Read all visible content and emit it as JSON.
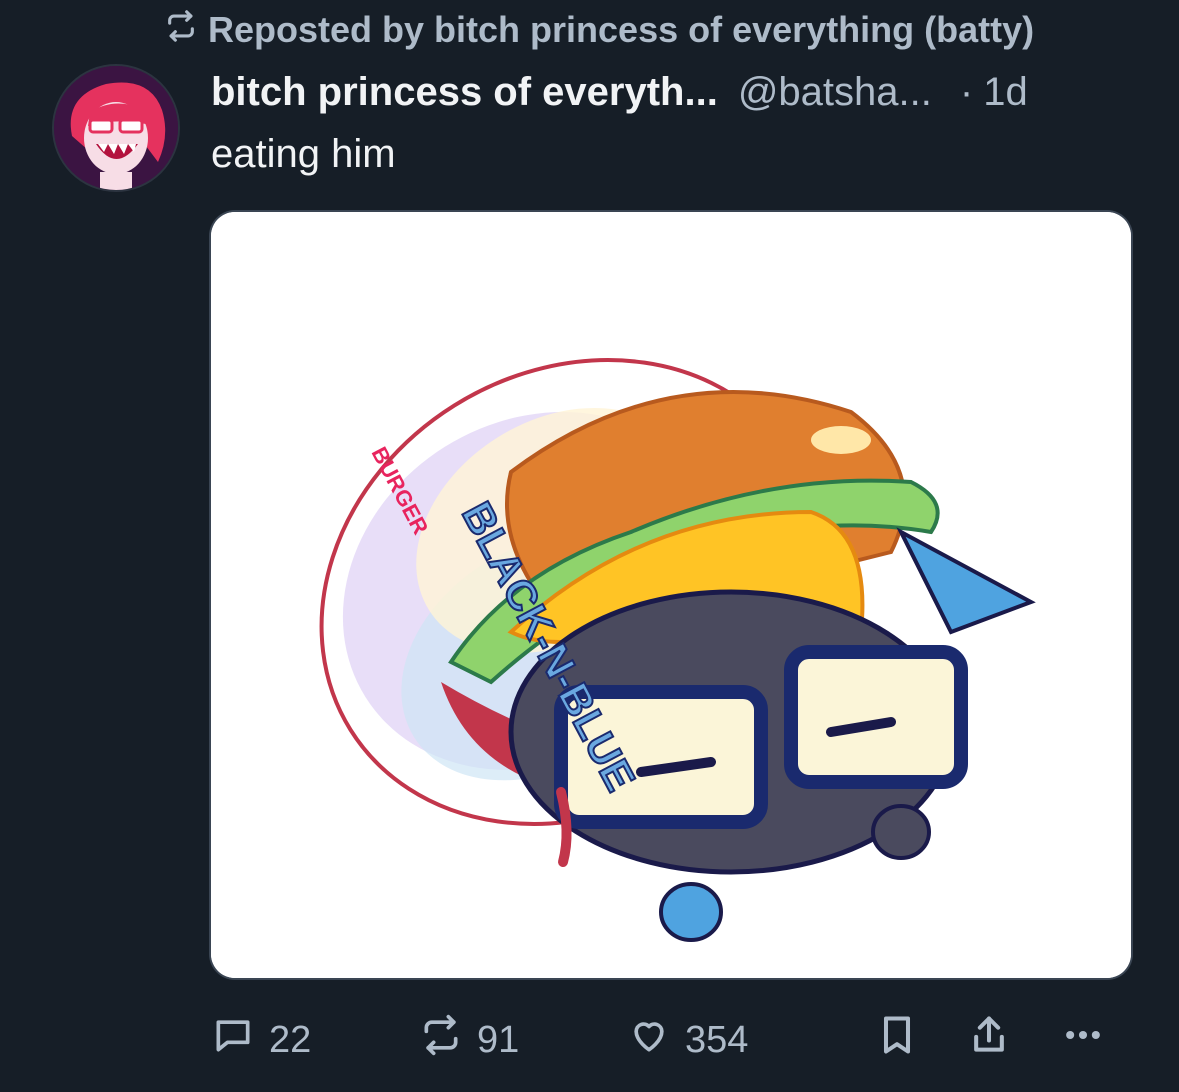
{
  "repost": {
    "label": "Reposted by bitch princess of everything (batty)"
  },
  "post": {
    "display_name": "bitch princess of everyth...",
    "handle": "@batsha...",
    "separator": "·",
    "time": "1d",
    "text": "eating him",
    "image_text": {
      "brand_main": "BLACK-N-BLUE",
      "brand_sub": "BURGER"
    }
  },
  "actions": {
    "replies": "22",
    "reposts": "91",
    "likes": "354"
  },
  "icons": {
    "repost_indicator": "repost-icon",
    "reply": "speech-bubble-icon",
    "repost": "repost-arrows-icon",
    "like": "heart-icon",
    "bookmark": "bookmark-icon",
    "share": "share-upload-icon",
    "more": "ellipsis-icon"
  },
  "colors": {
    "background": "#161e27",
    "muted_text": "#aebbc9",
    "primary_text": "#f1f3f5"
  }
}
